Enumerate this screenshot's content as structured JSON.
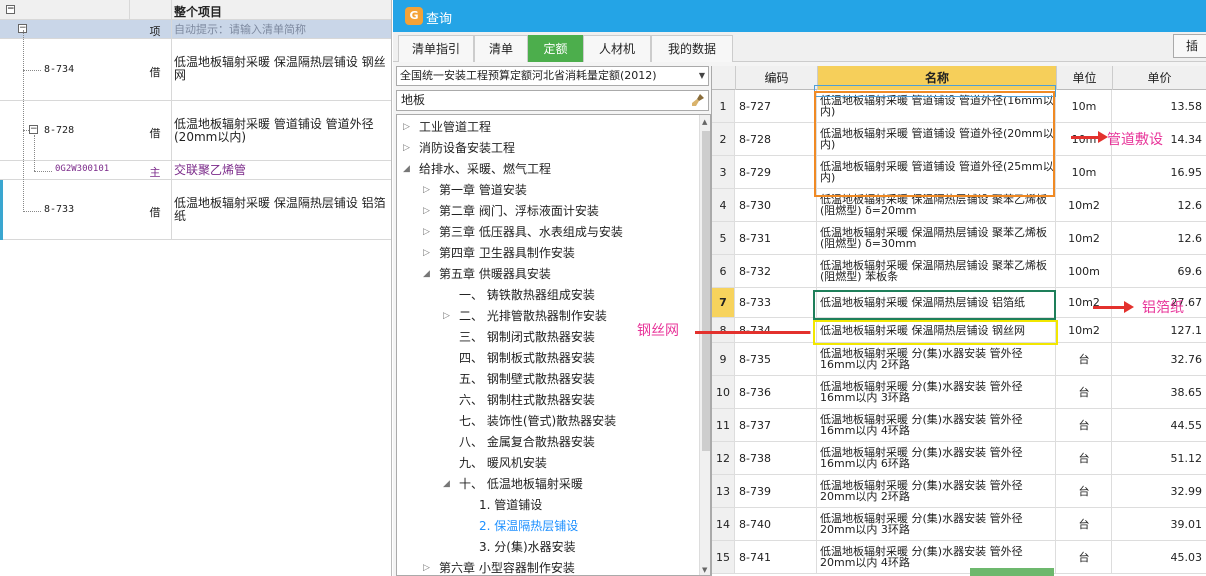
{
  "left_table": {
    "header": "整个项目",
    "rows": [
      {
        "type": "项",
        "name": "自动提示：请输入清单简称",
        "code": ""
      },
      {
        "code": "8-734",
        "type": "借",
        "name": "低温地板辐射采暖 保温隔热层铺设 钢丝网"
      },
      {
        "code": "8-728",
        "type": "借",
        "name": "低温地板辐射采暖 管道铺设 管道外径(20mm以内)"
      },
      {
        "code": "0G2W300101",
        "type": "主",
        "name": "交联聚乙烯管"
      },
      {
        "code": "8-733",
        "type": "借",
        "name": "低温地板辐射采暖 保温隔热层铺设 铝箔纸"
      }
    ]
  },
  "dialog": {
    "title": "查询",
    "tabs": [
      "清单指引",
      "清单",
      "定额",
      "人材机",
      "我的数据"
    ],
    "active_tab": "定额",
    "insert_label": "插",
    "quota_library": "全国统一安装工程预算定额河北省消耗量定额(2012)",
    "search_value": "地板",
    "tree": [
      {
        "label": "工业管道工程",
        "level": 0,
        "state": "collapsed"
      },
      {
        "label": "消防设备安装工程",
        "level": 0,
        "state": "collapsed"
      },
      {
        "label": "给排水、采暖、燃气工程",
        "level": 0,
        "state": "expanded"
      },
      {
        "label": "第一章 管道安装",
        "level": 1,
        "state": "collapsed"
      },
      {
        "label": "第二章 阀门、浮标液面计安装",
        "level": 1,
        "state": "collapsed"
      },
      {
        "label": "第三章 低压器具、水表组成与安装",
        "level": 1,
        "state": "collapsed"
      },
      {
        "label": "第四章 卫生器具制作安装",
        "level": 1,
        "state": "collapsed"
      },
      {
        "label": "第五章 供暖器具安装",
        "level": 1,
        "state": "expanded"
      },
      {
        "label": "一、 铸铁散热器组成安装",
        "level": 2,
        "state": "leaf"
      },
      {
        "label": "二、 光排管散热器制作安装",
        "level": 2,
        "state": "collapsed"
      },
      {
        "label": "三、 钢制闭式散热器安装",
        "level": 2,
        "state": "leaf"
      },
      {
        "label": "四、 钢制板式散热器安装",
        "level": 2,
        "state": "leaf"
      },
      {
        "label": "五、 钢制壁式散热器安装",
        "level": 2,
        "state": "leaf"
      },
      {
        "label": "六、 钢制柱式散热器安装",
        "level": 2,
        "state": "leaf"
      },
      {
        "label": "七、 装饰性(管式)散热器安装",
        "level": 2,
        "state": "leaf"
      },
      {
        "label": "八、 金属复合散热器安装",
        "level": 2,
        "state": "leaf"
      },
      {
        "label": "九、 暖风机安装",
        "level": 2,
        "state": "leaf"
      },
      {
        "label": "十、 低温地板辐射采暖",
        "level": 2,
        "state": "expanded"
      },
      {
        "label": "1. 管道铺设",
        "level": 3,
        "state": "leaf"
      },
      {
        "label": "2. 保温隔热层铺设",
        "level": 3,
        "state": "selected"
      },
      {
        "label": "3. 分(集)水器安装",
        "level": 3,
        "state": "leaf"
      },
      {
        "label": "第六章 小型容器制作安装",
        "level": 1,
        "state": "collapsed"
      }
    ],
    "grid": {
      "headers": [
        "编码",
        "名称",
        "单位",
        "单价"
      ],
      "current_row": "7",
      "rows": [
        {
          "no": "1",
          "code": "8-727",
          "name": "低温地板辐射采暖 管道铺设 管道外径(16mm以内)",
          "unit": "10m",
          "price": "13.58"
        },
        {
          "no": "2",
          "code": "8-728",
          "name": "低温地板辐射采暖 管道铺设 管道外径(20mm以内)",
          "unit": "10m",
          "price": "14.34"
        },
        {
          "no": "3",
          "code": "8-729",
          "name": "低温地板辐射采暖 管道铺设 管道外径(25mm以内)",
          "unit": "10m",
          "price": "16.95"
        },
        {
          "no": "4",
          "code": "8-730",
          "name": "低温地板辐射采暖 保温隔热层铺设 聚苯乙烯板(阻燃型) δ=20mm",
          "unit": "10m2",
          "price": "12.6"
        },
        {
          "no": "5",
          "code": "8-731",
          "name": "低温地板辐射采暖 保温隔热层铺设 聚苯乙烯板(阻燃型) δ=30mm",
          "unit": "10m2",
          "price": "12.6"
        },
        {
          "no": "6",
          "code": "8-732",
          "name": "低温地板辐射采暖 保温隔热层铺设 聚苯乙烯板(阻燃型) 苯板条",
          "unit": "100m",
          "price": "69.6"
        },
        {
          "no": "7",
          "code": "8-733",
          "name": "低温地板辐射采暖 保温隔热层铺设 铝箔纸",
          "unit": "10m2",
          "price": "27.67"
        },
        {
          "no": "8",
          "code": "8-734",
          "name": "低温地板辐射采暖 保温隔热层铺设 钢丝网",
          "unit": "10m2",
          "price": "127.1"
        },
        {
          "no": "9",
          "code": "8-735",
          "name": "低温地板辐射采暖 分(集)水器安装 管外径16mm以内 2环路",
          "unit": "台",
          "price": "32.76"
        },
        {
          "no": "10",
          "code": "8-736",
          "name": "低温地板辐射采暖 分(集)水器安装 管外径16mm以内 3环路",
          "unit": "台",
          "price": "38.65"
        },
        {
          "no": "11",
          "code": "8-737",
          "name": "低温地板辐射采暖 分(集)水器安装 管外径16mm以内 4环路",
          "unit": "台",
          "price": "44.55"
        },
        {
          "no": "12",
          "code": "8-738",
          "name": "低温地板辐射采暖 分(集)水器安装 管外径16mm以内 6环路",
          "unit": "台",
          "price": "51.12"
        },
        {
          "no": "13",
          "code": "8-739",
          "name": "低温地板辐射采暖 分(集)水器安装 管外径20mm以内 2环路",
          "unit": "台",
          "price": "32.99"
        },
        {
          "no": "14",
          "code": "8-740",
          "name": "低温地板辐射采暖 分(集)水器安装 管外径20mm以内 3环路",
          "unit": "台",
          "price": "39.01"
        },
        {
          "no": "15",
          "code": "8-741",
          "name": "低温地板辐射采暖 分(集)水器安装 管外径20mm以内 4环路",
          "unit": "台",
          "price": "45.03"
        }
      ]
    }
  },
  "annotations": {
    "pipe_laying": "管道敷设",
    "aluminum_foil": "铝箔纸",
    "steel_mesh": "钢丝网"
  },
  "colors": {
    "titlebar": "#24a4e6",
    "active_tab": "#4cae4c",
    "name_header": "#f6cf5a",
    "annotation_text": "#e8369a",
    "arrow": "#e3312d",
    "box_orange": "#f08a24",
    "box_green": "#1e7f5a",
    "box_yellow": "#f2e700",
    "box_blue": "#4f9fd6"
  }
}
